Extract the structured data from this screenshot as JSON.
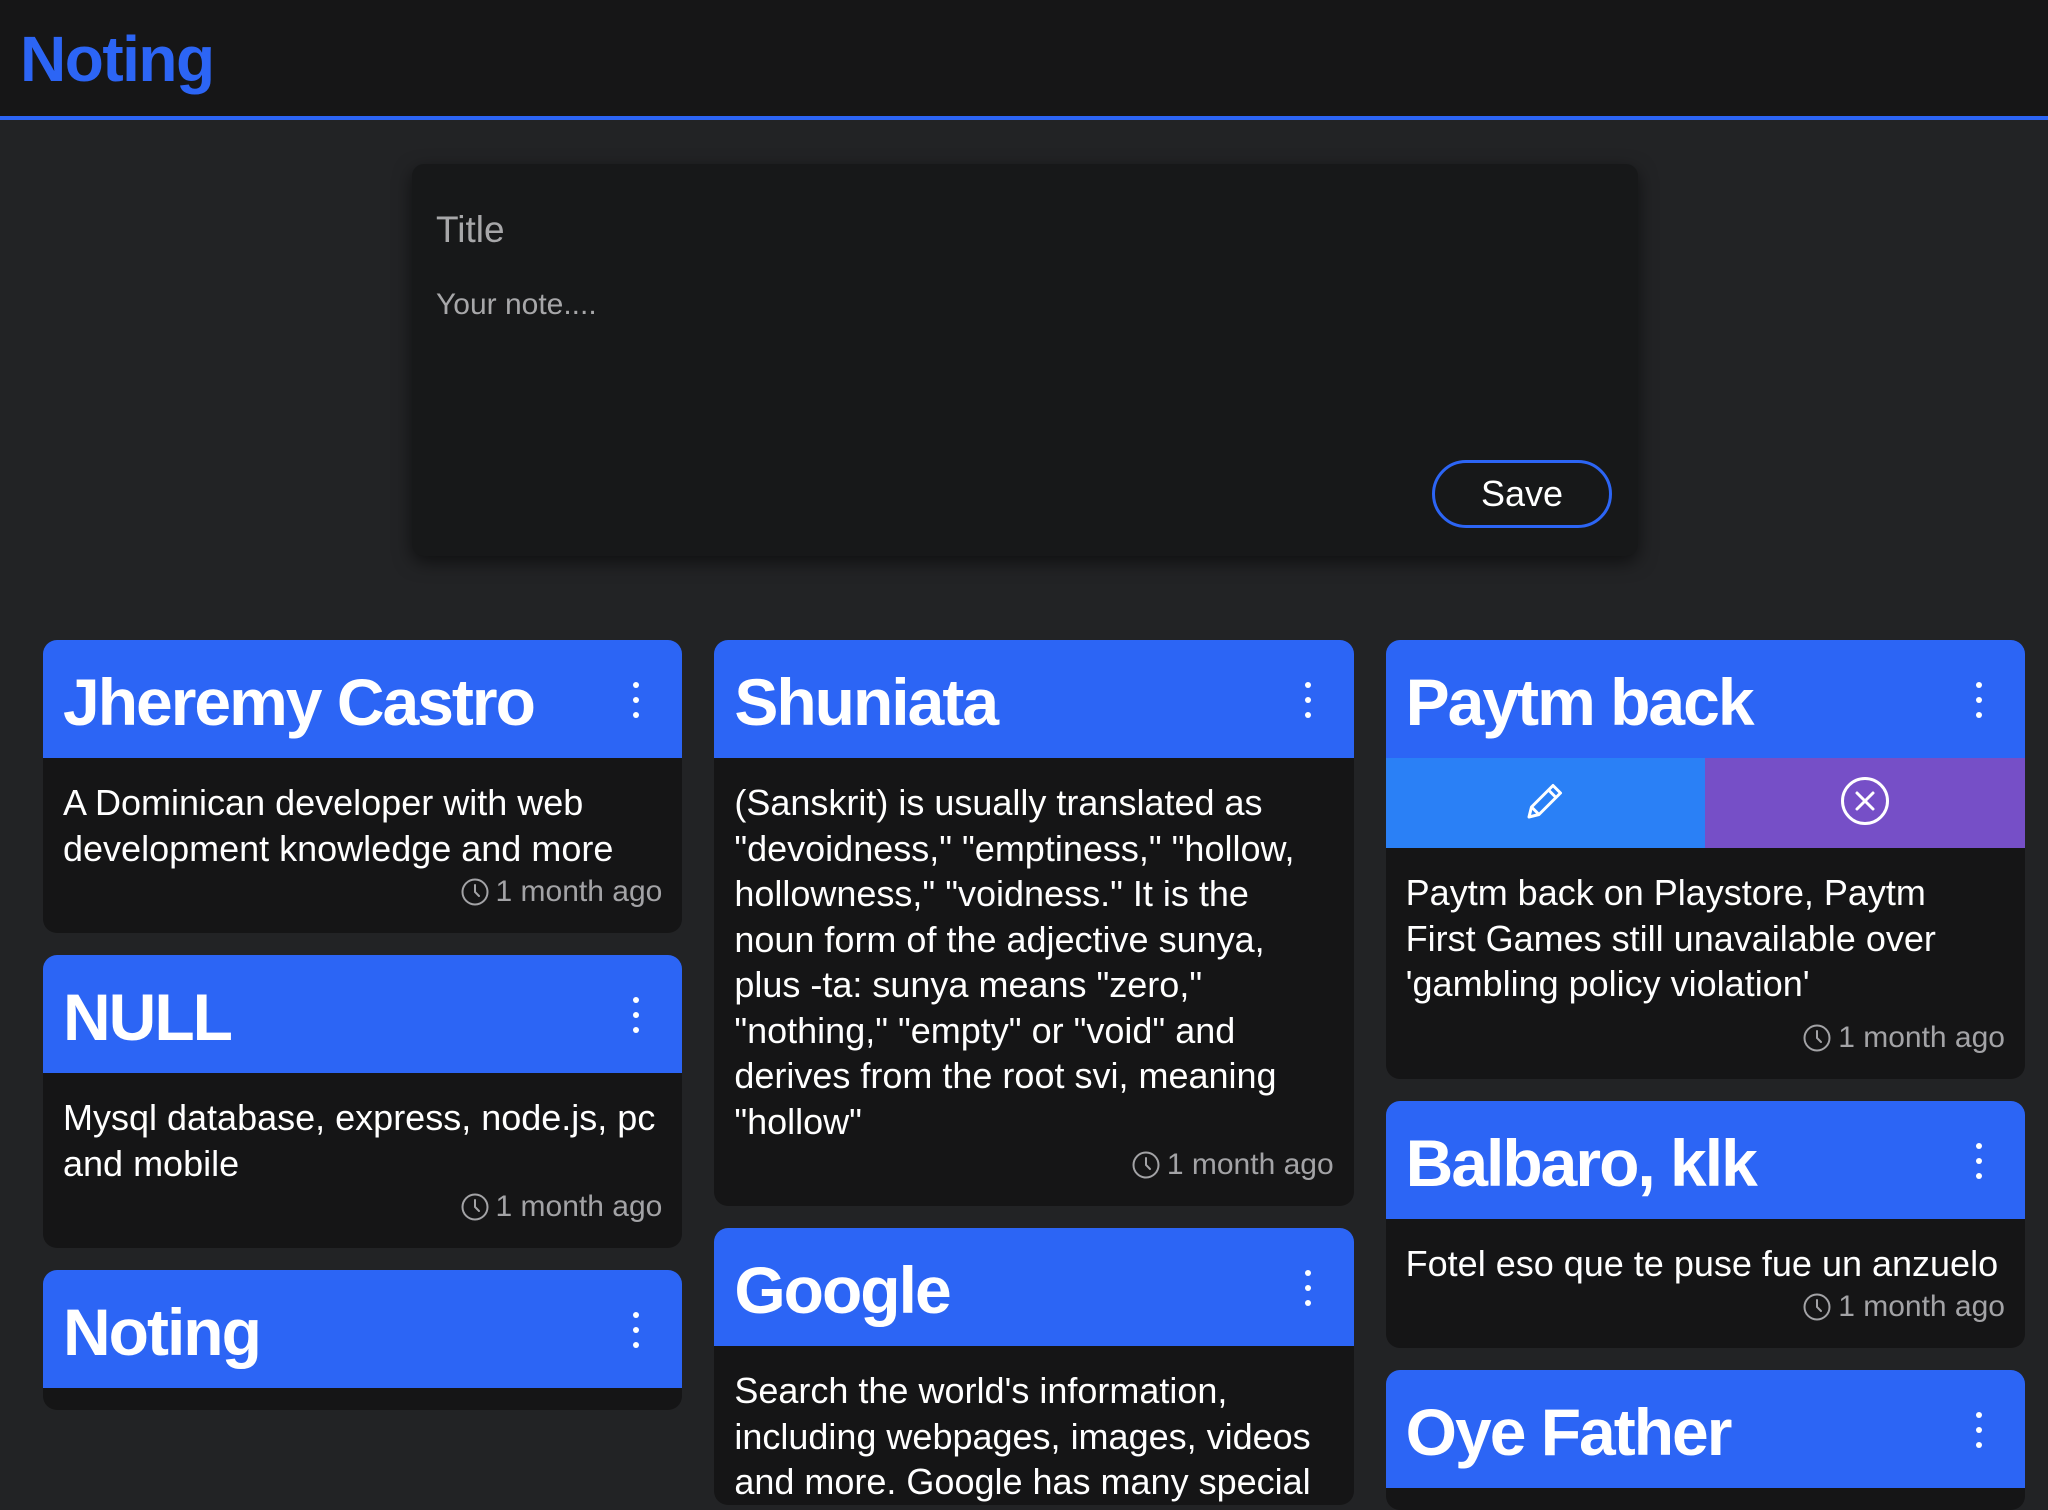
{
  "app": {
    "brand": "Noting"
  },
  "composer": {
    "title_placeholder": "Title",
    "note_placeholder": "Your note....",
    "save_label": "Save"
  },
  "columns": [
    [
      {
        "title": "Jheremy Castro",
        "body": "A Dominican developer with web development knowledge and more",
        "time": "1 month ago"
      },
      {
        "title": "NULL",
        "body": "Mysql database, express, node.js, pc and mobile",
        "time": "1 month ago"
      },
      {
        "title": "Noting",
        "body": "",
        "time": ""
      }
    ],
    [
      {
        "title": "Shuniata",
        "body": "(Sanskrit) is usually translated as \"devoidness,\" \"emptiness,\" \"hollow, hollowness,\" \"voidness.\" It is the noun form of the adjective sunya, plus -ta: sunya means \"zero,\" \"nothing,\" \"empty\" or \"void\" and derives from the root svi, meaning \"hollow\"",
        "time": "1 month ago"
      },
      {
        "title": "Google",
        "body": "Search the world's information, including webpages, images, videos and more. Google has many special",
        "time": ""
      }
    ],
    [
      {
        "title": "Paytm back",
        "actions_open": true,
        "body": "Paytm back on Playstore, Paytm First Games still unavailable over 'gambling policy violation'",
        "time": "1 month ago"
      },
      {
        "title": "Balbaro, klk",
        "body": "Fotel eso que te puse fue un anzuelo",
        "time": "1 month ago"
      },
      {
        "title": "Oye Father",
        "body": "",
        "time": ""
      }
    ]
  ],
  "colors": {
    "accent": "#2c65f5",
    "edit_action": "#2a80f6",
    "delete_action": "#764fc7",
    "background": "#222325",
    "card": "#151516",
    "muted_text": "#a3a3a6"
  },
  "icons": {
    "more": "more-vertical-icon",
    "edit": "pencil-icon",
    "delete": "close-circle-icon",
    "time": "clock-icon"
  }
}
